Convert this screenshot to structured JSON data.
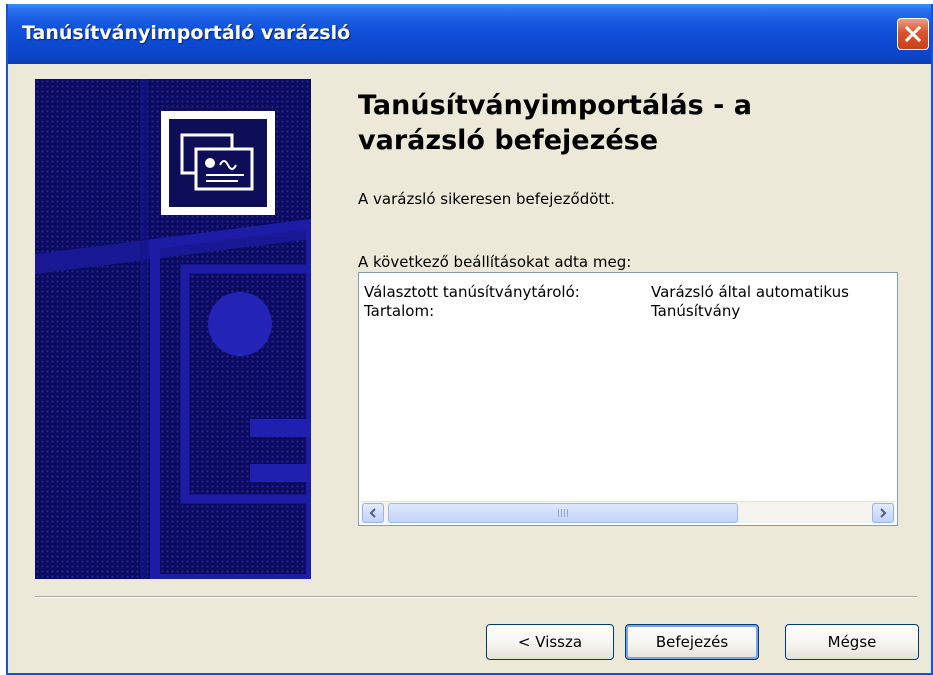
{
  "window": {
    "title": "Tanúsítványimportáló varázsló",
    "close_icon": "close-icon"
  },
  "colors": {
    "title_bar": "#0c47cc",
    "banner_bg": "#0b0b62",
    "close_button": "#d9532d",
    "dialog_bg": "#ece9d8"
  },
  "content": {
    "heading": "Tanúsítványimportálás - a varázsló befejezése",
    "description": "A varázsló sikeresen befejeződött.",
    "settings_label": "A következő beállításokat adta meg:",
    "settings": [
      {
        "key": "Választott tanúsítványtároló:",
        "value": "Varázsló által automatikus"
      },
      {
        "key": "Tartalom:",
        "value": "Tanúsítvány"
      }
    ]
  },
  "buttons": {
    "back": "< Vissza",
    "finish": "Befejezés",
    "cancel": "Mégse"
  }
}
